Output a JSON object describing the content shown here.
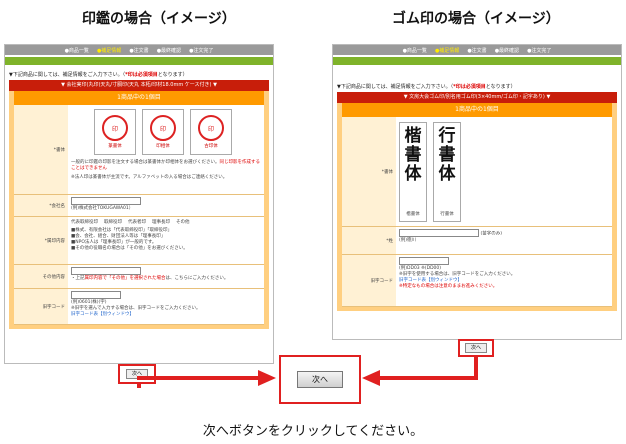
{
  "titles": {
    "left": "印鑑の場合（イメージ）",
    "right": "ゴム印の場合（イメージ）"
  },
  "steps": [
    "●商品一覧",
    "●補足情報",
    "●注文書",
    "●最終確認",
    "●注文完了"
  ],
  "current_step": "●補足情報",
  "notice": {
    "prefix": "▼下記商品に関しては、補足情報をご入力下さい。（",
    "mark": "*印は必須項目",
    "suffix": "となります）"
  },
  "left": {
    "product_bar": "▼ 会社実印(丸印)天丸/寸胴印(天丸 本柘/印材18.0mm ケース付き) ▼",
    "order_title": "1商品中の1個目",
    "font_label": "*書体",
    "fonts": [
      "篆書体",
      "印相体",
      "古印体"
    ],
    "font_note": "一般的に印鑑の印影を注文する場合は篆書体か印相体をお選びください。",
    "font_note_red": "同じ印影を作成することはできません",
    "font_note2": "※法人印は篆書体が主流です。アルファベットの入る場合はご連絡ください。",
    "company_label": "*会社名",
    "company_example": "(例)株式会社TOKUGAWA01）",
    "type_label": "*属印内容",
    "types": [
      "代表取締役印",
      "取締役印",
      "代表者印",
      "理事長印",
      "その他"
    ],
    "type_notes": [
      "■株式、有限会社は「代表取締役印」「取締役印」",
      "■会、会社、組合、財団法人等は「理事長印」",
      "■NPO法人は「理事長印」が一般的です。",
      "■その他の役職名の場合は「その他」をお選びください。"
    ],
    "other_label": "その他内容",
    "other_note": "・上記",
    "other_note_red": "属印内容で「その他」を選択された場合",
    "other_note2": "は、こちらにご入力ください。",
    "old_label": "旧字コード",
    "old_example": "(例)0601(株)(字)",
    "old_note": "※旧字を選んで入力する場合は、旧字コードをご入力ください。",
    "old_link": "旧字コード表【別ウィンドウ】",
    "next": "次へ"
  },
  "right": {
    "product_bar": "▼ 文房大会ゴム印/別名用ゴム印(3×40mm/ゴム印・記字あり) ▼",
    "order_title": "1商品中の1個目",
    "font_label": "*書体",
    "fonts": [
      "楷書体",
      "行書体"
    ],
    "glyph_left": [
      "楷",
      "書",
      "体"
    ],
    "glyph_right": [
      "行",
      "書",
      "体"
    ],
    "name_label": "*姓",
    "name_note": "(苗字のみ)",
    "name_example": "(例)徳川",
    "old_label": "旧字コード",
    "old_example": "(例)DD03 ※(DD00)",
    "old_note": "※旧字を使用する場合は、旧字コードをご入力ください。",
    "old_link": "旧字コード表【別ウィンドウ】",
    "old_red": "※特定なもの場合は注意のままお進みください。",
    "next": "次へ"
  },
  "center_button": "次へ",
  "caption": "次へボタンをクリックしてください。"
}
